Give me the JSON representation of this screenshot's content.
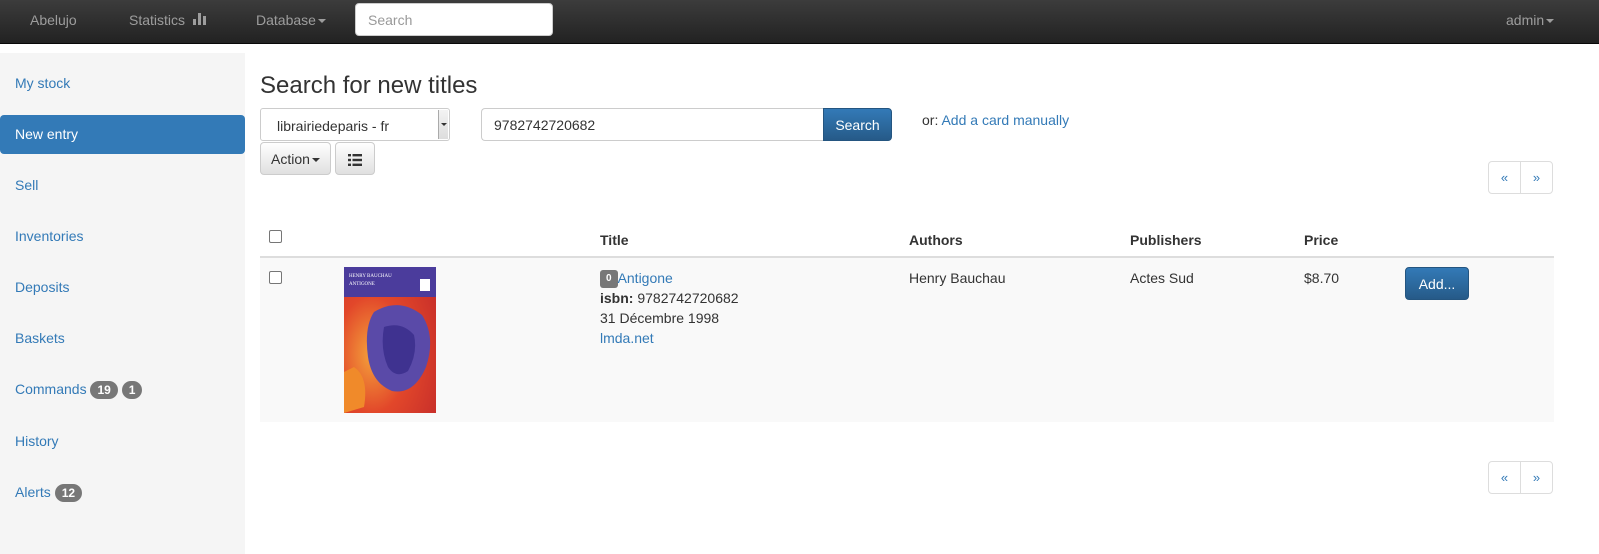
{
  "navbar": {
    "brand": "Abelujo",
    "statistics": "Statistics",
    "database": "Database",
    "search_placeholder": "Search",
    "user": "admin"
  },
  "sidebar": {
    "items": [
      {
        "label": "My stock"
      },
      {
        "label": "New entry",
        "active": true
      },
      {
        "label": "Sell"
      },
      {
        "label": "Inventories"
      },
      {
        "label": "Deposits"
      },
      {
        "label": "Baskets"
      },
      {
        "label": "Commands",
        "badges": [
          "19",
          "1"
        ]
      },
      {
        "label": "History"
      },
      {
        "label": "Alerts",
        "badges": [
          "12"
        ]
      }
    ]
  },
  "main": {
    "title": "Search for new titles",
    "source_selected": "librairiedeparis - fr",
    "isbn_value": "9782742720682",
    "search_button": "Search",
    "or_label": "or:",
    "add_card_link": "Add a card manually",
    "action_button": "Action",
    "list_icon": "list-icon",
    "pager": {
      "prev": "«",
      "next": "»"
    }
  },
  "table": {
    "headers": {
      "title": "Title",
      "authors": "Authors",
      "publishers": "Publishers",
      "price": "Price"
    },
    "rows": [
      {
        "qty": "0",
        "title": "Antigone",
        "isbn_label": "isbn:",
        "isbn": "9782742720682",
        "date": "31 Décembre 1998",
        "source": "lmda.net",
        "author": "Henry Bauchau",
        "publisher": "Actes Sud",
        "price": "$8.70",
        "add_button": "Add...",
        "cover": {
          "author": "HENRY BAUCHAU",
          "title": "ANTIGONE"
        }
      }
    ]
  },
  "colors": {
    "primary": "#337ab7",
    "navbar": "#222222",
    "sidebar": "#f5f5f5",
    "badge": "#777777"
  }
}
